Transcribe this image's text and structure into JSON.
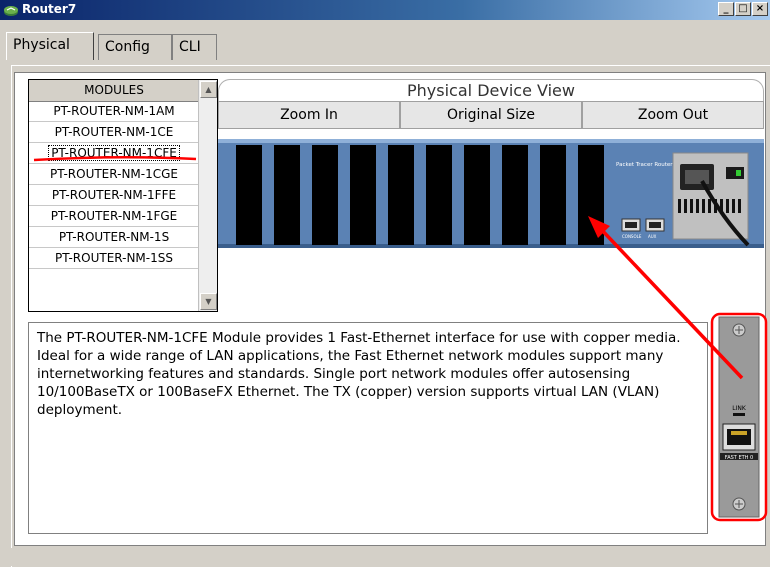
{
  "window": {
    "title": "Router7",
    "controls": [
      "_",
      "□",
      "×"
    ]
  },
  "tabs": [
    {
      "label": "Physical",
      "active": true
    },
    {
      "label": "Config",
      "active": false
    },
    {
      "label": "CLI",
      "active": false
    }
  ],
  "modules": {
    "header": "MODULES",
    "items": [
      "PT-ROUTER-NM-1AM",
      "PT-ROUTER-NM-1CE",
      "PT-ROUTER-NM-1CFE",
      "PT-ROUTER-NM-1CGE",
      "PT-ROUTER-NM-1FFE",
      "PT-ROUTER-NM-1FGE",
      "PT-ROUTER-NM-1S",
      "PT-ROUTER-NM-1SS"
    ],
    "selected": "PT-ROUTER-NM-1CFE"
  },
  "device_view": {
    "title": "Physical Device View",
    "zoom_in": "Zoom In",
    "original_size": "Original Size",
    "zoom_out": "Zoom Out",
    "router_label": "Packet Tracer Router",
    "console_label": "CONSOLE",
    "aux_label": "AUX"
  },
  "description": "The PT-ROUTER-NM-1CFE Module provides 1 Fast-Ethernet interface for use with copper media. Ideal for a wide range of LAN applications, the Fast Ethernet network modules support many internetworking features and standards. Single port network modules offer autosensing 10/100BaseTX or 100BaseFX Ethernet. The TX (copper) version supports virtual LAN (VLAN) deployment.",
  "module_card": {
    "link_label": "LINK",
    "port_label": "FAST ETH 0"
  },
  "colors": {
    "chassis_blue": "#5b82b4",
    "slot_black": "#000000",
    "annotation_red": "#ff0000",
    "titlebar": "#0a246a"
  }
}
